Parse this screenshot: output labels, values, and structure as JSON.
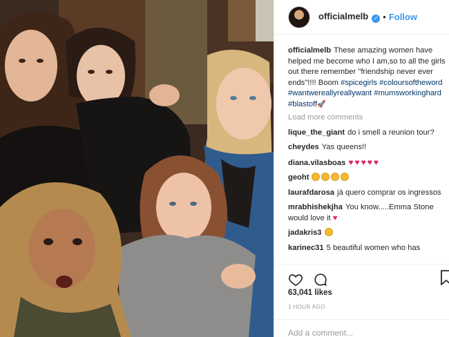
{
  "post": {
    "username": "officialmelb",
    "follow_label": "Follow",
    "separator": "•",
    "caption_text": "These amazing women have helped me become who I am,so to all the girls out there remember \"friendship never ever ends\"!!!! Boom",
    "hashtags": [
      "#spicegirls",
      "#coloursoftheword",
      "#wantwereallyreallywant",
      "#mumsworkinghard",
      "#blastoff"
    ],
    "load_more_label": "Load more comments",
    "comments": [
      {
        "user": "lique_the_giant",
        "text": "do i smell a reunion tour?"
      },
      {
        "user": "cheydes",
        "text": "Yas queens!!"
      },
      {
        "user": "diana.vilasboas",
        "text": "",
        "emoji": "♥♥♥♥♥"
      },
      {
        "user": "geoht",
        "text": "",
        "emoji": "faces"
      },
      {
        "user": "laurafdarosa",
        "text": "já quero comprar os ingressos"
      },
      {
        "user": "mrabhishekjha",
        "text": "You know.....Emma Stone would love it"
      },
      {
        "user": "jadakris3",
        "text": ""
      },
      {
        "user": "karinec31",
        "text": "5 beautiful women who has"
      }
    ],
    "likes": "63,041 likes",
    "timestamp": "1 HOUR AGO",
    "add_comment_placeholder": "Add a comment..."
  },
  "colors": {
    "link_blue": "#3897f0",
    "hashtag": "#003569",
    "muted": "#999999",
    "heart": "#e0245e"
  },
  "icons": {
    "like": "heart-outline-icon",
    "comment": "speech-bubble-icon",
    "save": "bookmark-icon",
    "verified": "verified-badge-icon"
  }
}
